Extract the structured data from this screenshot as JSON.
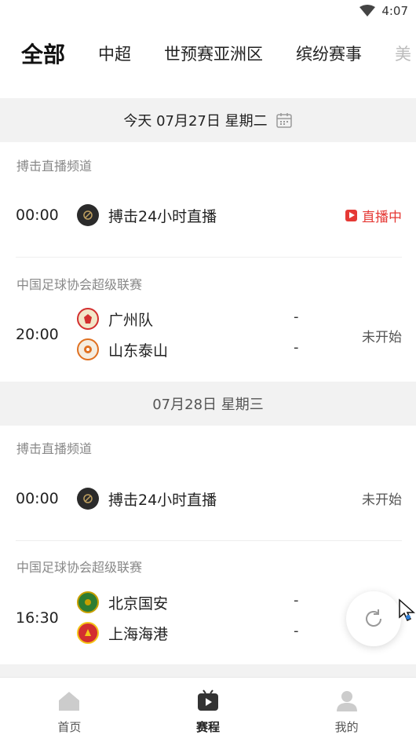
{
  "status_bar": {
    "time": "4:07"
  },
  "tabs": [
    "全部",
    "中超",
    "世预赛亚洲区",
    "缤纷赛事",
    "美"
  ],
  "days": [
    {
      "header": "今天 07月27日  星期二",
      "blocks": [
        {
          "league": "搏击直播频道",
          "time": "00:00",
          "single_name": "搏击24小时直播",
          "status": "直播中"
        },
        {
          "league": "中国足球协会超级联赛",
          "time": "20:00",
          "home": "广州队",
          "away": "山东泰山",
          "home_score": "-",
          "away_score": "-",
          "status": "未开始"
        }
      ]
    },
    {
      "header": "07月28日 星期三",
      "blocks": [
        {
          "league": "搏击直播频道",
          "time": "00:00",
          "single_name": "搏击24小时直播",
          "status": "未开始"
        },
        {
          "league": "中国足球协会超级联赛",
          "time": "16:30",
          "home": "北京国安",
          "away": "上海海港",
          "home_score": "-",
          "away_score": "-"
        }
      ]
    }
  ],
  "bottom_nav": [
    {
      "label": "首页",
      "icon": "home-icon"
    },
    {
      "label": "赛程",
      "icon": "schedule-icon"
    },
    {
      "label": "我的",
      "icon": "user-icon"
    }
  ],
  "colors": {
    "live": "#e53935",
    "header_bg": "#f2f2f2"
  }
}
